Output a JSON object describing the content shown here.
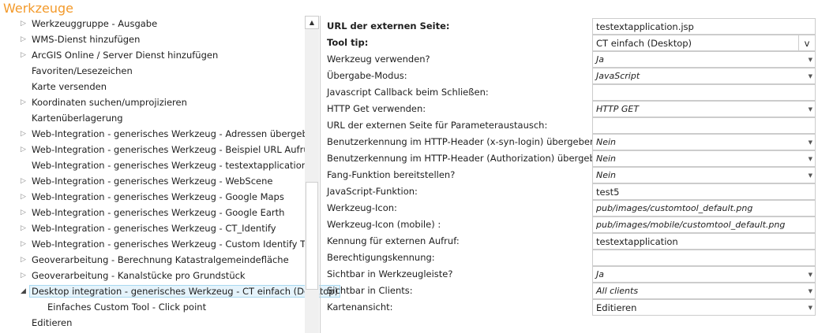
{
  "title": "Werkzeuge",
  "tree": [
    {
      "label": "Werkzeuggruppe - Ausgabe",
      "expander": "collapsed",
      "level": 1
    },
    {
      "label": "WMS-Dienst hinzufügen",
      "expander": "collapsed",
      "level": 1
    },
    {
      "label": "ArcGIS Online / Server Dienst hinzufügen",
      "expander": "collapsed",
      "level": 1
    },
    {
      "label": "Favoriten/Lesezeichen",
      "expander": "none",
      "level": 1
    },
    {
      "label": "Karte versenden",
      "expander": "none",
      "level": 1
    },
    {
      "label": "Koordinaten suchen/umprojizieren",
      "expander": "collapsed",
      "level": 1
    },
    {
      "label": "Kartenüberlagerung",
      "expander": "none",
      "level": 1
    },
    {
      "label": "Web-Integration - generisches Werkzeug - Adressen übergeben",
      "expander": "collapsed",
      "level": 1
    },
    {
      "label": "Web-Integration - generisches Werkzeug - Beispiel URL Aufrufe",
      "expander": "collapsed",
      "level": 1
    },
    {
      "label": "Web-Integration - generisches Werkzeug - testextapplication",
      "expander": "none",
      "level": 1
    },
    {
      "label": "Web-Integration - generisches Werkzeug - WebScene",
      "expander": "collapsed",
      "level": 1
    },
    {
      "label": "Web-Integration - generisches Werkzeug - Google Maps",
      "expander": "collapsed",
      "level": 1
    },
    {
      "label": "Web-Integration - generisches Werkzeug - Google Earth",
      "expander": "collapsed",
      "level": 1
    },
    {
      "label": "Web-Integration - generisches Werkzeug - CT_Identify",
      "expander": "collapsed",
      "level": 1
    },
    {
      "label": "Web-Integration - generisches Werkzeug - Custom Identify Tool",
      "expander": "collapsed",
      "level": 1
    },
    {
      "label": "Geoverarbeitung - Berechnung Katastralgemeindefläche",
      "expander": "collapsed",
      "level": 1
    },
    {
      "label": "Geoverarbeitung - Kanalstücke pro Grundstück",
      "expander": "collapsed",
      "level": 1
    },
    {
      "label": "Desktop integration - generisches Werkzeug - CT einfach (Desktop)",
      "expander": "expanded",
      "level": 1,
      "selected": true
    },
    {
      "label": "Einfaches Custom Tool - Click point",
      "expander": "none",
      "level": 2
    },
    {
      "label": "Editieren",
      "expander": "none",
      "level": 1
    }
  ],
  "properties": [
    {
      "label": "URL der externen Seite:",
      "bold": true,
      "value": "testextapplication.jsp",
      "type": "text"
    },
    {
      "label": "Tool tip:",
      "bold": true,
      "value": "CT einfach (Desktop)",
      "type": "button",
      "button": "v"
    },
    {
      "label": "Werkzeug verwenden?",
      "value": "Ja",
      "type": "dropdown"
    },
    {
      "label": "Übergabe-Modus:",
      "value": "JavaScript",
      "type": "dropdown"
    },
    {
      "label": "Javascript Callback beim Schließen:",
      "value": "",
      "type": "text"
    },
    {
      "label": "HTTP Get verwenden:",
      "value": "HTTP GET",
      "type": "dropdown"
    },
    {
      "label": "URL der externen Seite für Parameteraustausch:",
      "value": "",
      "type": "text"
    },
    {
      "label": "Benutzerkennung im HTTP-Header (x-syn-login) übergeben?",
      "value": "Nein",
      "type": "dropdown"
    },
    {
      "label": "Benutzerkennung im HTTP-Header (Authorization) übergeben?",
      "value": "Nein",
      "type": "dropdown"
    },
    {
      "label": "Fang-Funktion bereitstellen?",
      "value": "Nein",
      "type": "dropdown"
    },
    {
      "label": "JavaScript-Funktion:",
      "value": "test5",
      "type": "text"
    },
    {
      "label": "Werkzeug-Icon:",
      "value": "pub/images/customtool_default.png",
      "type": "italic"
    },
    {
      "label": "Werkzeug-Icon (mobile) :",
      "value": "pub/images/mobile/customtool_default.png",
      "type": "italic"
    },
    {
      "label": "Kennung für externen Aufruf:",
      "value": "testextapplication",
      "type": "text"
    },
    {
      "label": "Berechtigungskennung:",
      "value": "",
      "type": "text"
    },
    {
      "label": "Sichtbar in Werkzeugleiste?",
      "value": "Ja",
      "type": "dropdown"
    },
    {
      "label": "Sichtbar in Clients:",
      "value": "All clients",
      "type": "dropdown"
    },
    {
      "label": "Kartenansicht:",
      "value": "Editieren",
      "type": "dropdown-plain"
    }
  ]
}
